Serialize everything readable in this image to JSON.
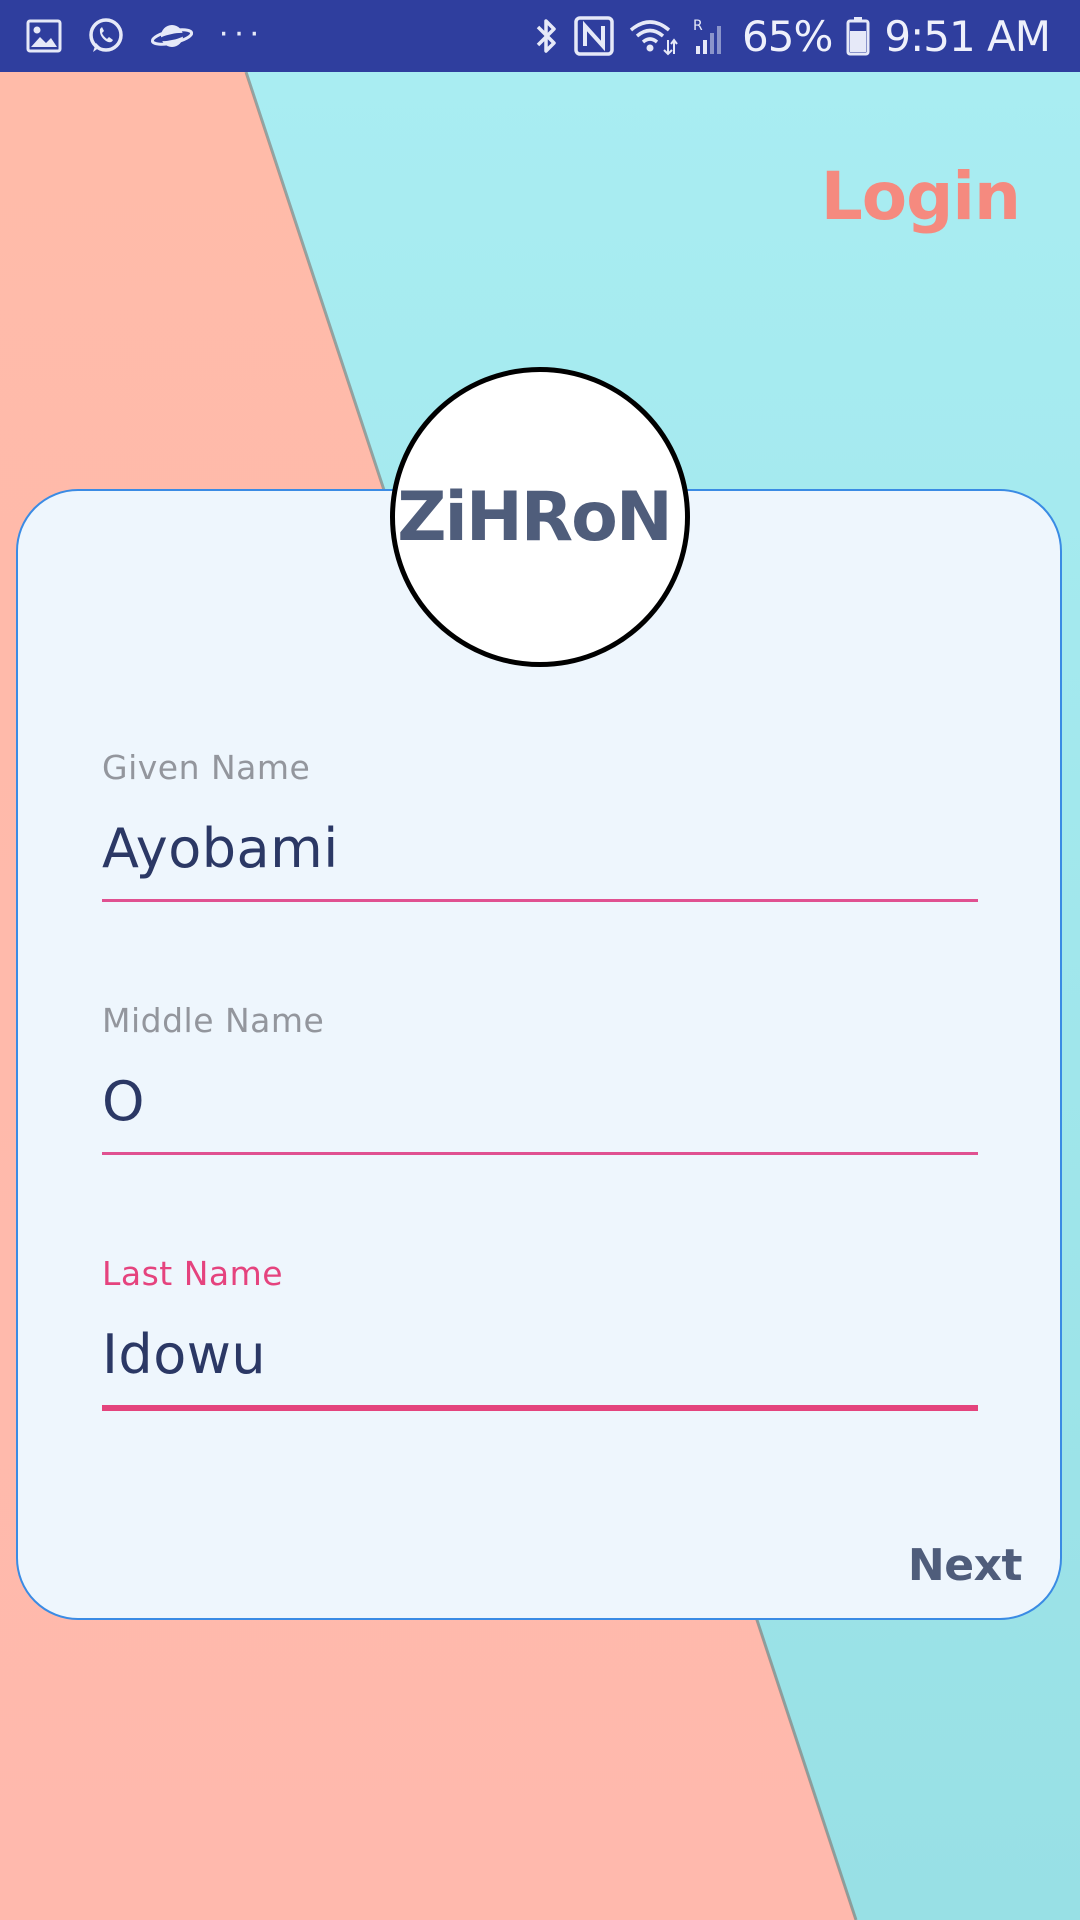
{
  "status_bar": {
    "icons_left": [
      "gallery-icon",
      "whatsapp-icon",
      "planet-icon"
    ],
    "more": "···",
    "icons_right": [
      "bluetooth-icon",
      "nfc-icon",
      "wifi-icon",
      "signal-icon",
      "battery-icon"
    ],
    "battery_percent": "65%",
    "time": "9:51 AM"
  },
  "header": {
    "login_label": "Login"
  },
  "logo": {
    "text": "ZiHRoN"
  },
  "form": {
    "given_name": {
      "label": "Given Name",
      "value": "Ayobami"
    },
    "middle_name": {
      "label": "Middle Name",
      "value": "O"
    },
    "last_name": {
      "label": "Last Name",
      "value": "Idowu"
    },
    "next_label": "Next"
  },
  "colors": {
    "status_bar": "#2f3e9e",
    "peach": "#fdb8a8",
    "aqua": "#a6ecf0",
    "accent_pink": "#e4447d",
    "login_coral": "#f58a7f",
    "card_border": "#3a8be4"
  }
}
